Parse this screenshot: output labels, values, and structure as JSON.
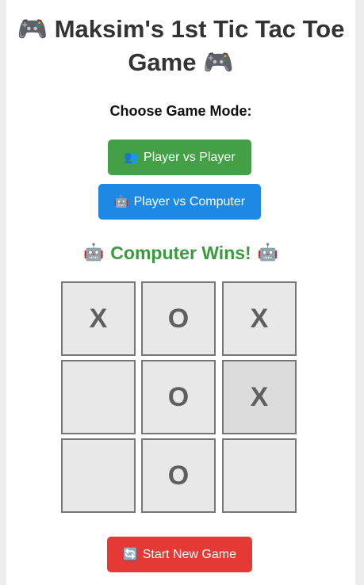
{
  "title": "🎮 Maksim's 1st Tic Tac Toe Game 🎮",
  "mode_label": "Choose Game Mode:",
  "buttons": {
    "pvp": {
      "icon": "👥",
      "label": "Player vs Player",
      "icon_name": "people-icon"
    },
    "pvc": {
      "icon": "🤖",
      "label": "Player vs Computer",
      "icon_name": "robot-icon"
    },
    "new_game": {
      "icon": "🔄",
      "label": "Start New Game",
      "icon_name": "refresh-icon"
    }
  },
  "status": {
    "icon": "🤖",
    "text": "Computer Wins!"
  },
  "board": {
    "cells": [
      "X",
      "O",
      "X",
      "",
      "O",
      "X",
      "",
      "O",
      ""
    ]
  },
  "colors": {
    "pvp": "#43a047",
    "pvc": "#1e88e5",
    "new_game": "#e53935",
    "status": "#3a9a3f"
  }
}
